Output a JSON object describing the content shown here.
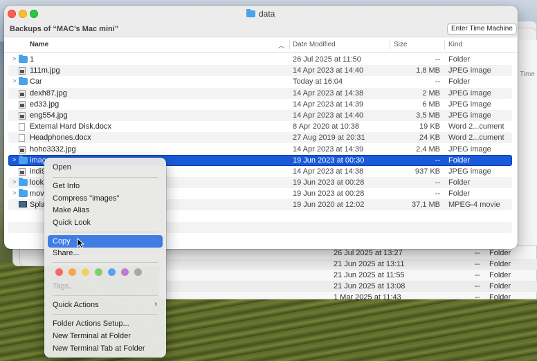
{
  "window": {
    "title": "data",
    "backup_label": "Backups of “MAC’s Mac mini”",
    "time_machine_button": "Enter Time Machine"
  },
  "columns": {
    "name": "Name",
    "date": "Date Modified",
    "size": "Size",
    "kind": "Kind"
  },
  "rows": [
    {
      "name": "1",
      "date": "26 Jul 2025 at 11:50",
      "size": "--",
      "kind": "Folder"
    },
    {
      "name": "111m.jpg",
      "date": "14 Apr 2023 at 14:40",
      "size": "1,8 MB",
      "kind": "JPEG image"
    },
    {
      "name": "Car",
      "date": "Today at 16:04",
      "size": "--",
      "kind": "Folder"
    },
    {
      "name": "dexh87.jpg",
      "date": "14 Apr 2023 at 14:38",
      "size": "2 MB",
      "kind": "JPEG image"
    },
    {
      "name": "ed33.jpg",
      "date": "14 Apr 2023 at 14:39",
      "size": "6 MB",
      "kind": "JPEG image"
    },
    {
      "name": "eng554.jpg",
      "date": "14 Apr 2023 at 14:40",
      "size": "3,5 MB",
      "kind": "JPEG image"
    },
    {
      "name": "External Hard Disk.docx",
      "date": "8 Apr 2020 at 10:38",
      "size": "19 KB",
      "kind": "Word 2...cument"
    },
    {
      "name": "Headphones.docx",
      "date": "27 Aug 2019 at 20:31",
      "size": "24 KB",
      "kind": "Word 2...cument"
    },
    {
      "name": "hoho3332.jpg",
      "date": "14 Apr 2023 at 14:39",
      "size": "2,4 MB",
      "kind": "JPEG image"
    },
    {
      "name": "imag",
      "date": "19 Jun 2023 at 00:30",
      "size": "--",
      "kind": "Folder"
    },
    {
      "name": "indi9",
      "date": "14 Apr 2023 at 14:38",
      "size": "937 KB",
      "kind": "JPEG image"
    },
    {
      "name": "look",
      "date": "19 Jun 2023 at 00:28",
      "size": "--",
      "kind": "Folder"
    },
    {
      "name": "movi",
      "date": "19 Jun 2023 at 00:28",
      "size": "--",
      "kind": "Folder"
    },
    {
      "name": "Spla",
      "date": "19 Jun 2020 at 12:02",
      "size": "37,1 MB",
      "kind": "MPEG-4 movie"
    }
  ],
  "background_rows": [
    {
      "date": "26 Jul 2025 at 13:27",
      "size": "--",
      "kind": "Folder"
    },
    {
      "date": "21 Jun 2025 at 13:11",
      "size": "--",
      "kind": "Folder"
    },
    {
      "date": "21 Jun 2025 at 11:55",
      "size": "--",
      "kind": "Folder"
    },
    {
      "date": "21 Jun 2025 at 13:08",
      "size": "--",
      "kind": "Folder"
    },
    {
      "date": "1 Mar 2025 at 11:43",
      "size": "--",
      "kind": "Folder"
    }
  ],
  "background_header_fragment": "Time M",
  "context_menu": {
    "open": "Open",
    "get_info": "Get Info",
    "compress": "Compress \"images\"",
    "make_alias": "Make Alias",
    "quick_look": "Quick Look",
    "copy": "Copy",
    "share": "Share...",
    "tags": "Tags...",
    "quick_actions": "Quick Actions",
    "folder_actions_setup": "Folder Actions Setup...",
    "new_terminal": "New Terminal at Folder",
    "new_terminal_tab": "New Terminal Tab at Folder",
    "tag_colors": [
      "#f26b67",
      "#f6a54a",
      "#f1d15c",
      "#7fcf6f",
      "#5ea0ee",
      "#bf7ad6",
      "#a8a8a8"
    ]
  }
}
